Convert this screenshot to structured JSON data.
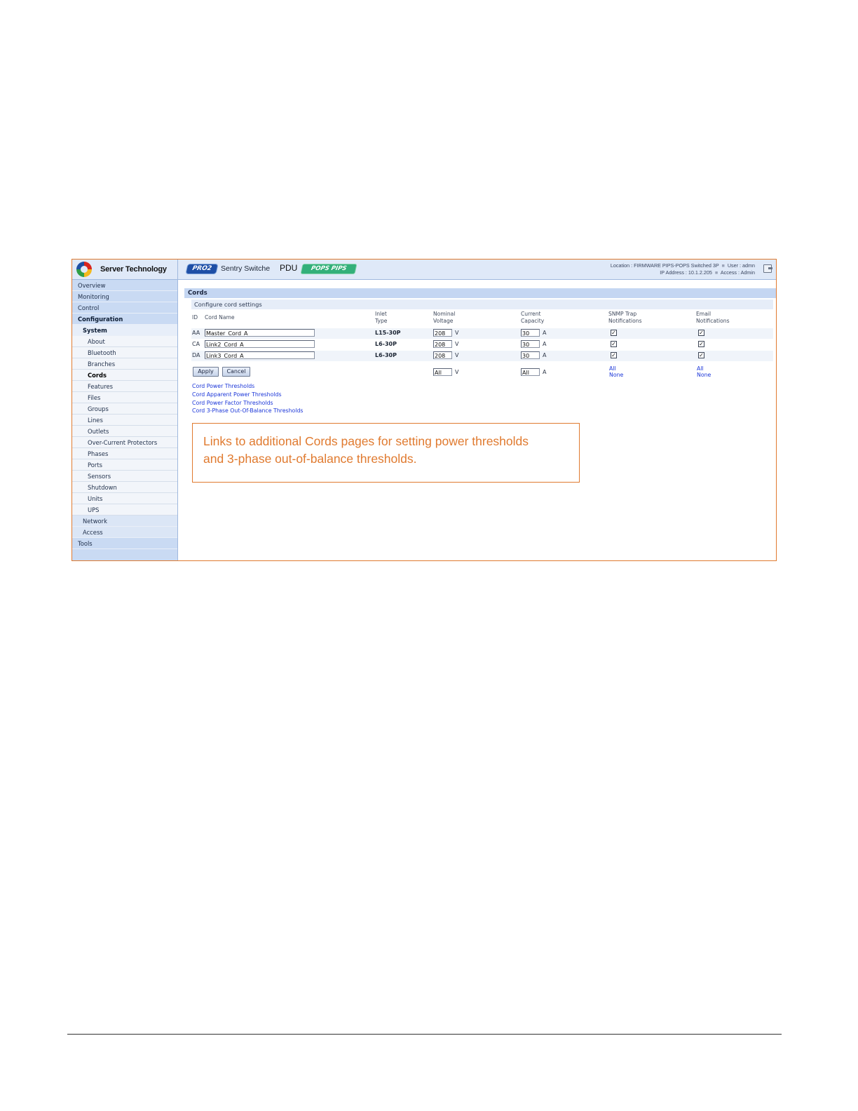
{
  "brand": {
    "name": "Server Technology"
  },
  "header": {
    "pro_badge": "PRO2",
    "product": "Sentry Switche",
    "pdu": "PDU",
    "pops_badge": "POPS PIPS",
    "location_label": "Location :",
    "location_value": "FIRMWARE PIPS-POPS Switched 3P",
    "user_label": "User :",
    "user_value": "admn",
    "ip_label": "IP Address :",
    "ip_value": "10.1.2.205",
    "access_label": "Access :",
    "access_value": "Admin"
  },
  "sidebar": {
    "items": [
      "Overview",
      "Monitoring",
      "Control",
      "Configuration",
      "System",
      "About",
      "Bluetooth",
      "Branches",
      "Cords",
      "Features",
      "Files",
      "Groups",
      "Lines",
      "Outlets",
      "Over-Current Protectors",
      "Phases",
      "Ports",
      "Sensors",
      "Shutdown",
      "Units",
      "UPS",
      "Network",
      "Access",
      "Tools"
    ]
  },
  "main": {
    "section_title": "Cords",
    "subtitle": "Configure cord settings",
    "columns": {
      "id": "ID",
      "name": "Cord Name",
      "inlet_1": "Inlet",
      "inlet_2": "Type",
      "voltage_1": "Nominal",
      "voltage_2": "Voltage",
      "capacity_1": "Current",
      "capacity_2": "Capacity",
      "snmp_1": "SNMP Trap",
      "snmp_2": "Notifications",
      "email_1": "Email",
      "email_2": "Notifications"
    },
    "rows": [
      {
        "id": "AA",
        "name": "Master_Cord_A",
        "inlet": "L15-30P",
        "voltage": "208",
        "v_unit": "V",
        "capacity": "30",
        "a_unit": "A",
        "snmp": "✓",
        "email": "✓"
      },
      {
        "id": "CA",
        "name": "Link2_Cord_A",
        "inlet": "L6-30P",
        "voltage": "208",
        "v_unit": "V",
        "capacity": "30",
        "a_unit": "A",
        "snmp": "✓",
        "email": "✓"
      },
      {
        "id": "DA",
        "name": "Link3_Cord_A",
        "inlet": "L6-30P",
        "voltage": "208",
        "v_unit": "V",
        "capacity": "30",
        "a_unit": "A",
        "snmp": "✓",
        "email": "✓"
      }
    ],
    "apply": "Apply",
    "cancel": "Cancel",
    "all_voltage": "All",
    "all_v_unit": "V",
    "all_capacity": "All",
    "all_a_unit": "A",
    "snmp_all": "All",
    "snmp_none": "None",
    "email_all": "All",
    "email_none": "None",
    "links": [
      "Cord Power Thresholds",
      "Cord Apparent Power Thresholds",
      "Cord Power Factor Thresholds",
      "Cord 3-Phase Out-Of-Balance Thresholds"
    ]
  },
  "callout": {
    "line1": "Links to additional Cords pages for setting power thresholds",
    "line2": "and 3-phase out-of-balance thresholds."
  },
  "colors": {
    "accent_orange": "#e07a2f",
    "link_blue": "#1a35d8",
    "nav_blue": "#c9daf3"
  }
}
